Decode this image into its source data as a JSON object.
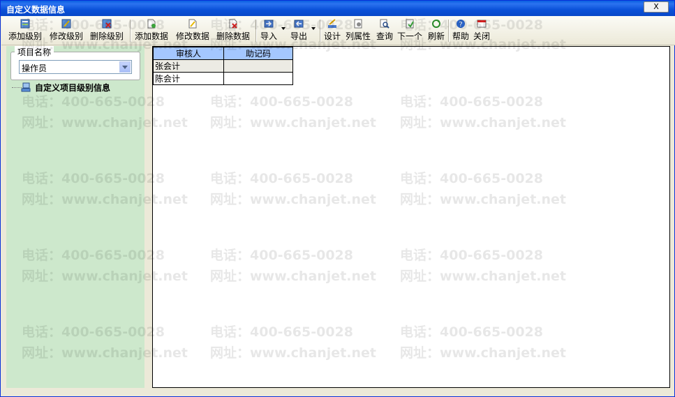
{
  "window": {
    "title": "自定义数据信息",
    "close_label": "X"
  },
  "toolbar": {
    "add_level": "添加级别",
    "edit_level": "修改级别",
    "delete_level": "删除级别",
    "add_data": "添加数据",
    "edit_data": "修改数据",
    "delete_data": "删除数据",
    "import": "导入",
    "export": "导出",
    "design": "设计",
    "column_props": "列属性",
    "query": "查询",
    "next": "下一个",
    "refresh": "刷新",
    "help": "帮助",
    "close": "关闭"
  },
  "left": {
    "group_label": "项目名称",
    "combo_value": "操作员",
    "tree_root": "自定义项目级别信息"
  },
  "grid": {
    "headers": [
      "审核人",
      "助记码"
    ],
    "rows": [
      [
        "张会计",
        ""
      ],
      [
        "陈会计",
        ""
      ]
    ]
  },
  "watermark": {
    "phone": "电话：400-665-0028",
    "site": "网址：www.chanjet.net"
  },
  "colors": {
    "title_bar": "#0a50d8",
    "left_panel": "#cde8cc",
    "grid_header": "#a4c7ff"
  }
}
